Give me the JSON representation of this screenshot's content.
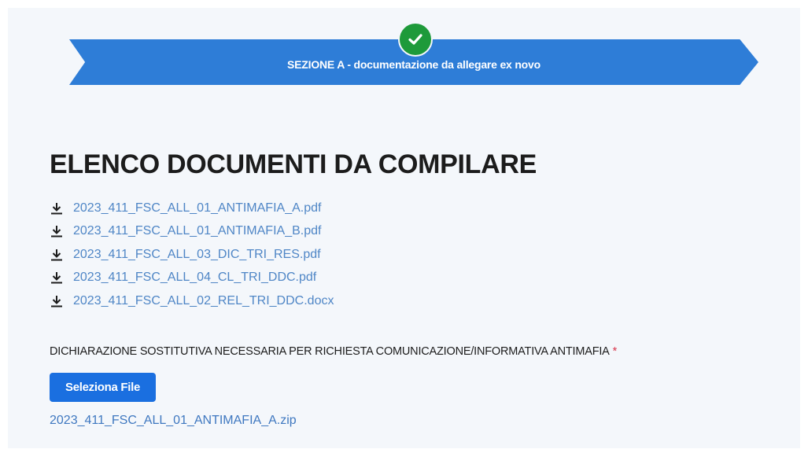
{
  "header": {
    "section_title": "SEZIONE A - documentazione da allegare ex novo",
    "status_icon": "checkmark-icon",
    "banner_color": "#2e7dd7",
    "check_color": "#1e9a3a"
  },
  "main": {
    "title": "ELENCO DOCUMENTI DA COMPILARE",
    "documents": [
      {
        "icon": "download-icon",
        "name": "2023_411_FSC_ALL_01_ANTIMAFIA_A.pdf"
      },
      {
        "icon": "download-icon",
        "name": "2023_411_FSC_ALL_01_ANTIMAFIA_B.pdf"
      },
      {
        "icon": "download-icon",
        "name": "2023_411_FSC_ALL_03_DIC_TRI_RES.pdf"
      },
      {
        "icon": "download-icon",
        "name": "2023_411_FSC_ALL_04_CL_TRI_DDC.pdf"
      },
      {
        "icon": "download-icon",
        "name": "2023_411_FSC_ALL_02_REL_TRI_DDC.docx"
      }
    ],
    "upload": {
      "label": "DICHIARAZIONE SOSTITUTIVA NECESSARIA PER RICHIESTA COMUNICAZIONE/INFORMATIVA ANTIMAFIA",
      "required_marker": "*",
      "button_label": "Seleziona File",
      "uploaded_file": "2023_411_FSC_ALL_01_ANTIMAFIA_A.zip"
    }
  }
}
